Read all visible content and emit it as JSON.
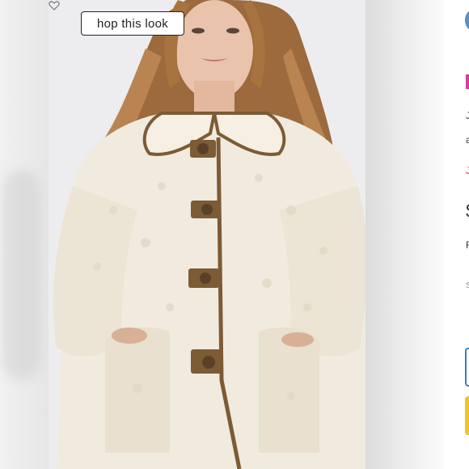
{
  "hero": {
    "shop_this_look_label": "hop this look",
    "plus_glyph": "+"
  },
  "right_panel": {
    "line1": "J",
    "line2": "a",
    "line3": "J",
    "price": "$",
    "line5": "F",
    "line6": "S"
  },
  "icons": {
    "favorite": "heart-icon",
    "zoom": "plus-icon"
  },
  "colors": {
    "brand": "#d83aa7",
    "accent_blue": "#3a7ec3",
    "cta_yellow": "#f3c325",
    "sale_red": "#d0243b",
    "coat": "#f1ebdf",
    "trim": "#7c5b35"
  }
}
